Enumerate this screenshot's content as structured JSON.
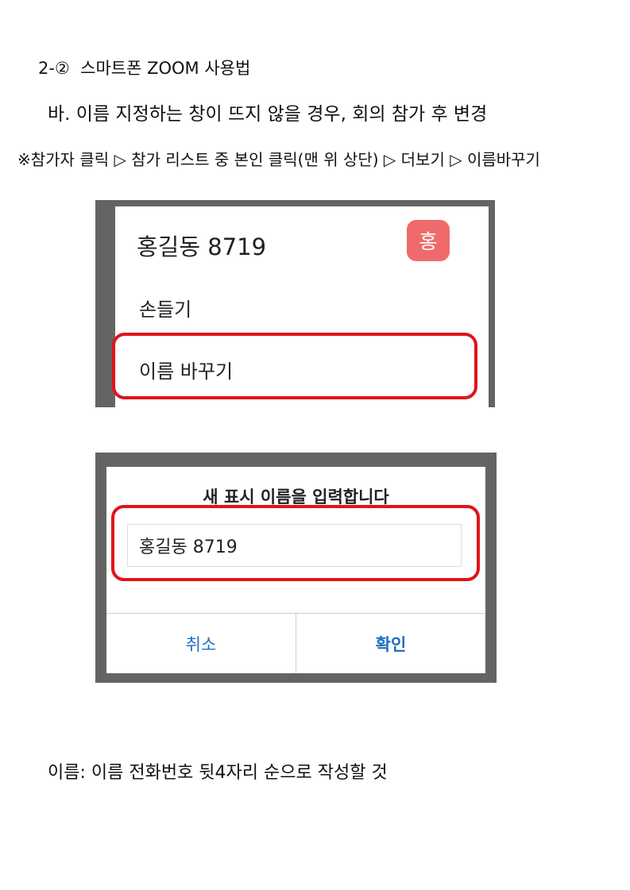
{
  "heading": {
    "number": "2-②",
    "title_prefix": "스마트폰",
    "title_en": "ZOOM",
    "title_suffix": "사용법"
  },
  "subheading": "바. 이름 지정하는 창이 뜨지 않을 경우, 회의 참가 후 변경",
  "note": "※참가자 클릭 ▷ 참가 리스트 중 본인 클릭(맨 위 상단) ▷ 더보기 ▷ 이름바꾸기",
  "screenshot1": {
    "participant_name": "홍길동 8719",
    "avatar_text": "홍",
    "avatar_color": "#ef6b6b",
    "menu": [
      "손들기",
      "이름 바꾸기"
    ]
  },
  "screenshot2": {
    "dialog_title": "새 표시 이름을 입력합니다",
    "input_value": "홍길동 8719",
    "cancel_label": "취소",
    "ok_label": "확인",
    "button_color": "#1d6fc1"
  },
  "highlight_color": "#e0141a",
  "footer": "이름: 이름 전화번호 뒷4자리 순으로 작성할 것"
}
